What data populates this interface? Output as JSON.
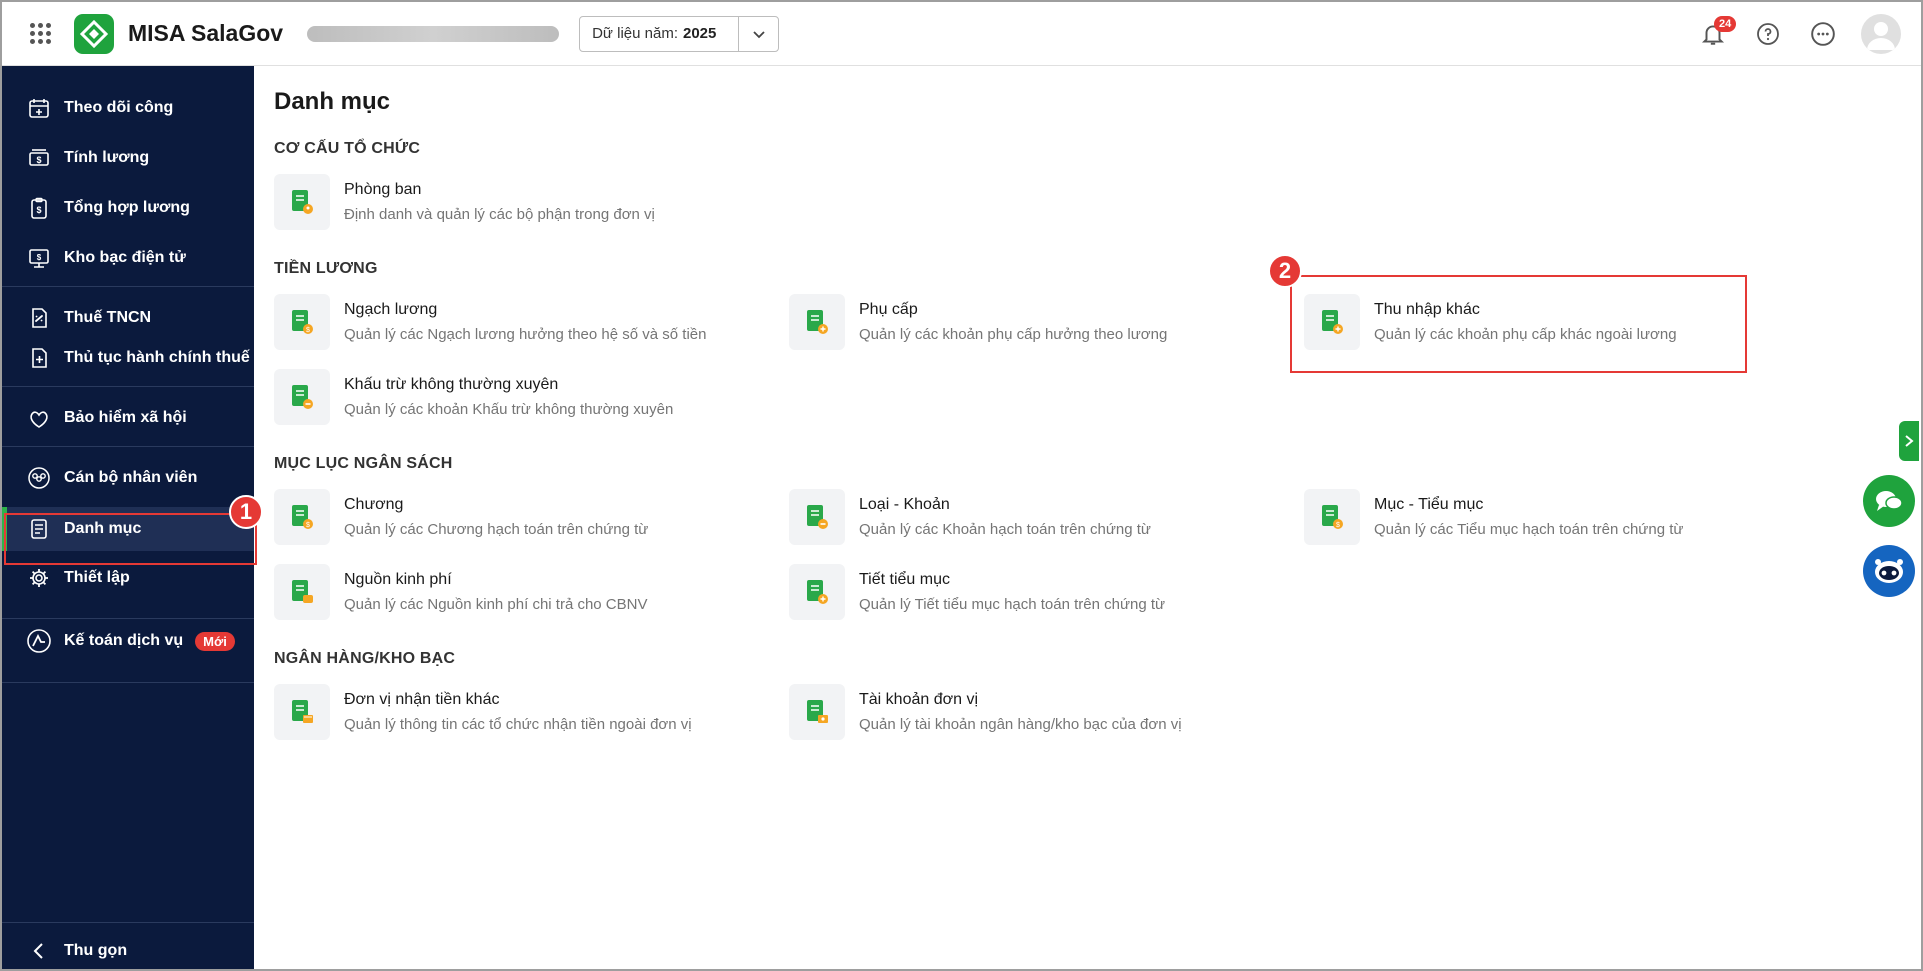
{
  "header": {
    "app_name": "MISA SalaGov",
    "year_label": "Dữ liệu năm:",
    "year_value": "2025",
    "notification_count": "24"
  },
  "sidebar": {
    "items": [
      {
        "label": "Theo dõi công",
        "icon": "calendar-plus-icon"
      },
      {
        "label": "Tính lương",
        "icon": "money-icon"
      },
      {
        "label": "Tổng hợp lương",
        "icon": "clipboard-dollar-icon"
      },
      {
        "label": "Kho bạc điện tử",
        "icon": "treasury-icon"
      },
      {
        "label": "Thuế TNCN",
        "icon": "tax-document-icon"
      },
      {
        "label": "Thủ tục hành chính thuế",
        "icon": "document-plus-icon"
      },
      {
        "label": "Bảo hiểm xã hội",
        "icon": "heart-shield-icon"
      },
      {
        "label": "Cán bộ nhân viên",
        "icon": "people-icon"
      },
      {
        "label": "Danh mục",
        "icon": "list-document-icon"
      },
      {
        "label": "Thiết lập",
        "icon": "gear-icon"
      },
      {
        "label": "Kế toán dịch vụ",
        "icon": "accounting-icon",
        "badge": "Mới"
      }
    ],
    "collapse_label": "Thu gọn",
    "active_item": "Danh mục"
  },
  "annotations": [
    "1",
    "2"
  ],
  "main": {
    "title": "Danh mục",
    "sections": [
      {
        "title": "CƠ CẤU TỔ CHỨC",
        "cards": [
          {
            "name": "Phòng ban",
            "desc": "Định danh và quản lý các bộ phận trong đơn vị"
          }
        ]
      },
      {
        "title": "TIỀN LƯƠNG",
        "cards": [
          {
            "name": "Ngạch lương",
            "desc": "Quản lý các Ngạch lương hưởng theo hệ số và số tiền"
          },
          {
            "name": "Phụ cấp",
            "desc": "Quản lý các khoản phụ cấp hưởng theo lương"
          },
          {
            "name": "Thu nhập khác",
            "desc": "Quản lý các khoản phụ cấp khác ngoài lương"
          },
          {
            "name": "Khấu trừ không thường xuyên",
            "desc": "Quản lý các khoản Khấu trừ không thường xuyên"
          }
        ]
      },
      {
        "title": "MỤC LỤC NGÂN SÁCH",
        "cards": [
          {
            "name": "Chương",
            "desc": "Quản lý các Chương hạch toán trên chứng từ"
          },
          {
            "name": "Loại - Khoản",
            "desc": "Quản lý các Khoản hạch toán trên chứng từ"
          },
          {
            "name": "Mục - Tiểu mục",
            "desc": "Quản lý các Tiểu mục hạch toán trên chứng từ"
          },
          {
            "name": "Nguồn kinh phí",
            "desc": "Quản lý các Nguồn kinh phí chi trả cho CBNV"
          },
          {
            "name": "Tiết tiểu mục",
            "desc": "Quản lý Tiết tiểu mục hạch toán trên chứng từ"
          }
        ]
      },
      {
        "title": "NGÂN HÀNG/KHO BẠC",
        "cards": [
          {
            "name": "Đơn vị nhận tiền khác",
            "desc": "Quản lý thông tin các tổ chức nhận tiền ngoài đơn vị"
          },
          {
            "name": "Tài khoản đơn vị",
            "desc": "Quản lý tài khoản ngân hàng/kho bạc của đơn vị"
          }
        ]
      }
    ]
  },
  "colors": {
    "brand_green": "#1fa33d",
    "sidebar_bg": "#0b1a3d",
    "annotation_red": "#e53935",
    "card_icon_accent": "#f5a623"
  }
}
